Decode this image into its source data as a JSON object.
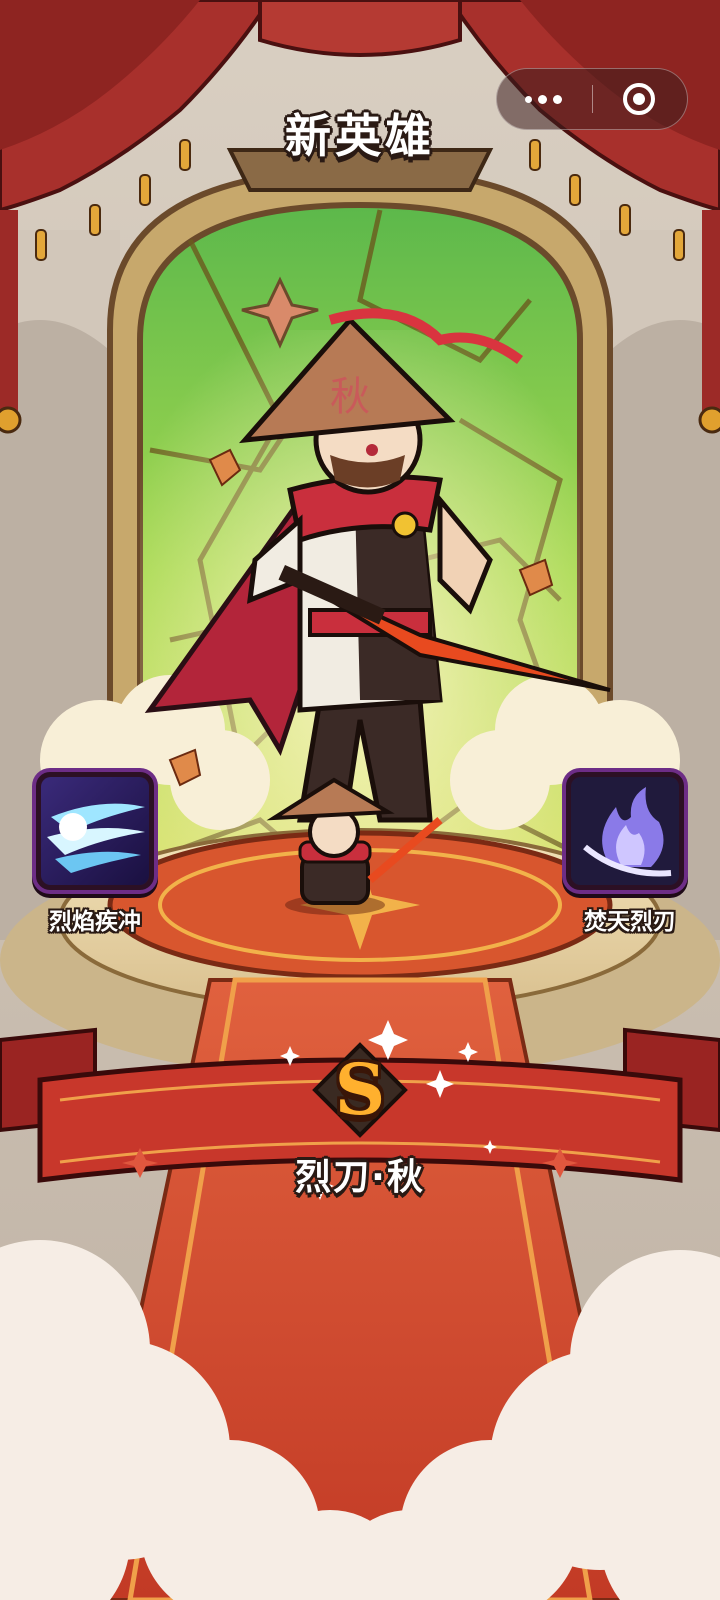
{
  "screen": {
    "title": "新英雄"
  },
  "hero": {
    "rank": "S",
    "name": "烈刀·秋"
  },
  "skills": [
    {
      "name": "烈焰疾冲",
      "icon": "dash-icon"
    },
    {
      "name": "焚天烈刃",
      "icon": "flame-blade-icon"
    }
  ],
  "capsule": {
    "more_icon": "more-dots-icon",
    "close_icon": "target-circle-icon"
  },
  "colors": {
    "curtain": "#a8302c",
    "carpet": "#d2452f",
    "banner": "#c8372b",
    "rank_gold": "#ffb02e",
    "skill_frame": "#6d2d86",
    "stained_glass": "#8fd25a"
  }
}
